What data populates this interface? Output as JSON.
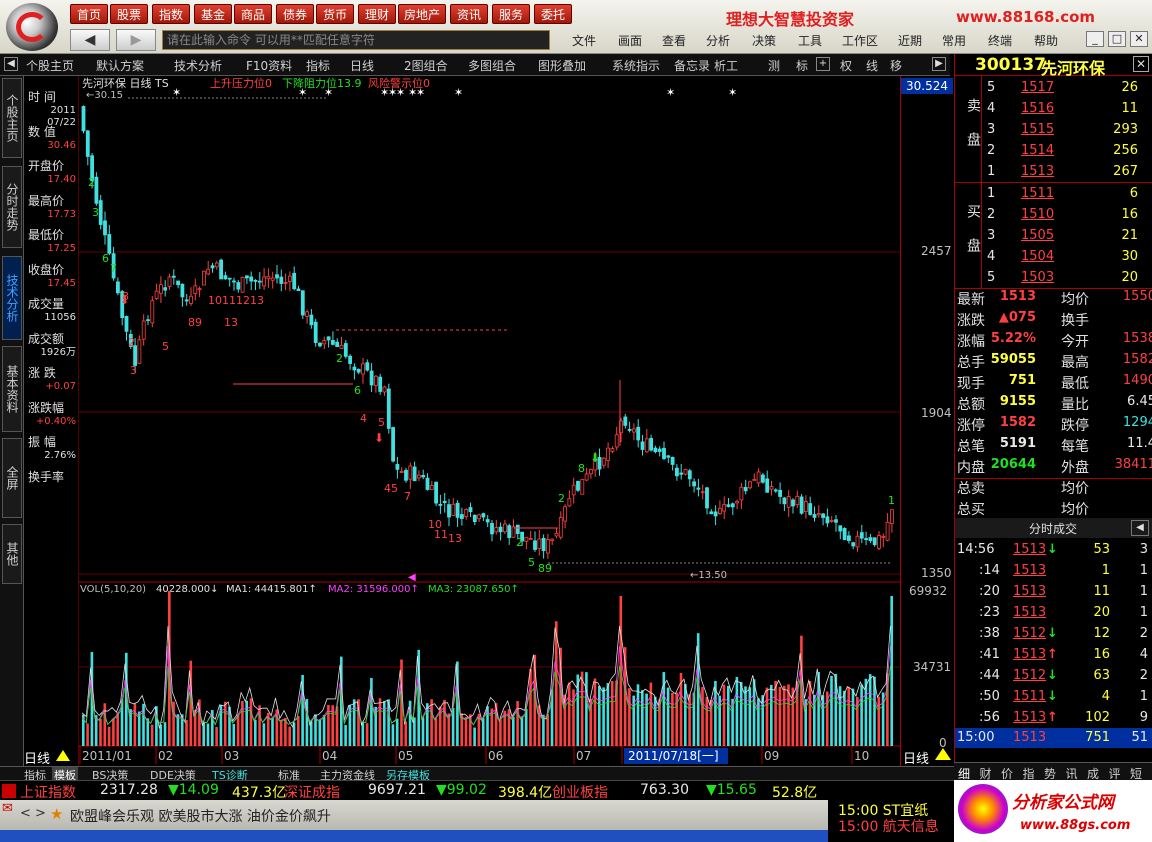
{
  "top_menu": [
    "首页",
    "股票",
    "指数",
    "基金",
    "商品",
    "债券",
    "货币",
    "理财",
    "房地产",
    "资讯",
    "服务",
    "委托"
  ],
  "brand": "理想大智慧投资家",
  "site": "www.88168.com",
  "command_placeholder": "请在此输入命令  可以用**匹配任意字符",
  "menus": [
    "文件",
    "画面",
    "查看",
    "分析",
    "决策",
    "工具",
    "工作区",
    "近期",
    "常用",
    "终端",
    "帮助"
  ],
  "toolbar": [
    "个股主页",
    "默认方案",
    "技术分析",
    "F10资料",
    "指标",
    "日线",
    "2图组合",
    "多图组合",
    "图形叠加",
    "系统指示",
    "备忘录",
    "析工",
    "测",
    "标",
    "权",
    "线",
    "移"
  ],
  "left_tabs": [
    "个股主页",
    "分时走势",
    "技术分析",
    "基本资料",
    "全屏",
    "其他"
  ],
  "data_panel": [
    {
      "label": "时  间",
      "value": "2011\n07/22"
    },
    {
      "label": "数  值",
      "value": "30.46"
    },
    {
      "label": "开盘价",
      "value": "17.40"
    },
    {
      "label": "最高价",
      "value": "17.73"
    },
    {
      "label": "最低价",
      "value": "17.25"
    },
    {
      "label": "收盘价",
      "value": "17.45"
    },
    {
      "label": "成交量",
      "value": "11056"
    },
    {
      "label": "成交额",
      "value": "1926万"
    },
    {
      "label": "涨  跌",
      "value": "+0.07"
    },
    {
      "label": "涨跌幅",
      "value": "+0.40%"
    },
    {
      "label": "振  幅",
      "value": "2.76%"
    },
    {
      "label": "换手率",
      "value": ""
    }
  ],
  "chart": {
    "legend_price": "先河环保 日线 TS",
    "legend_up": "上升压力位0",
    "legend_down": "下降阻力位13.9",
    "legend_risk": "风险警示位0",
    "high_tag": "30.524",
    "top_label": "←30.15",
    "low_label": "←13.50",
    "price_ticks": [
      "2457",
      "1904",
      "1350"
    ],
    "vol_legend": "VOL(5,10,20)",
    "vol_val": "40228.000↓",
    "ma1": "MA1: 44415.801↑",
    "ma2": "MA2: 31596.000↑",
    "ma3": "MA3: 23087.650↑",
    "vol_ticks": [
      "69932",
      "34731",
      "0"
    ],
    "x_labels": [
      "2011/01",
      "02",
      "03",
      "04",
      "05",
      "06",
      "07",
      "08",
      "09",
      "10"
    ],
    "x_highlight": "2011/07/18[一]",
    "period": "日线"
  },
  "rpanel": {
    "code": "300137",
    "name": "先河环保",
    "sell_label": "卖盘",
    "buy_label": "买盘",
    "sell": [
      [
        "5",
        "1517",
        "26"
      ],
      [
        "4",
        "1516",
        "11"
      ],
      [
        "3",
        "1515",
        "293"
      ],
      [
        "2",
        "1514",
        "256"
      ],
      [
        "1",
        "1513",
        "267"
      ]
    ],
    "buy": [
      [
        "1",
        "1511",
        "6"
      ],
      [
        "2",
        "1510",
        "16"
      ],
      [
        "3",
        "1505",
        "21"
      ],
      [
        "4",
        "1504",
        "30"
      ],
      [
        "5",
        "1503",
        "20"
      ]
    ],
    "stats": [
      [
        "最新",
        "1513",
        "均价",
        "1550"
      ],
      [
        "涨跌",
        "▲075",
        "换手",
        ""
      ],
      [
        "涨幅",
        "5.22%",
        "今开",
        "1538"
      ],
      [
        "总手",
        "59055",
        "最高",
        "1582"
      ],
      [
        "现手",
        "751",
        "最低",
        "1490"
      ],
      [
        "总额",
        "9155",
        "量比",
        "6.45"
      ],
      [
        "涨停",
        "1582",
        "跌停",
        "1294"
      ],
      [
        "总笔",
        "5191",
        "每笔",
        "11.4"
      ],
      [
        "内盘",
        "20644",
        "外盘",
        "38411"
      ],
      [
        "总卖",
        "",
        "均价",
        ""
      ],
      [
        "总买",
        "",
        "均价",
        ""
      ]
    ],
    "ticks_title": "分时成交",
    "ticks": [
      [
        "14:56",
        "1513",
        "↓",
        "53",
        "3"
      ],
      [
        ":14",
        "1513",
        "",
        "1",
        "1"
      ],
      [
        ":20",
        "1513",
        "",
        "11",
        "1"
      ],
      [
        ":23",
        "1513",
        "",
        "20",
        "1"
      ],
      [
        ":38",
        "1512",
        "↓",
        "12",
        "2"
      ],
      [
        ":41",
        "1513",
        "↑",
        "16",
        "4"
      ],
      [
        ":44",
        "1512",
        "↓",
        "63",
        "2"
      ],
      [
        ":50",
        "1511",
        "↓",
        "4",
        "1"
      ],
      [
        ":56",
        "1513",
        "↑",
        "102",
        "9"
      ]
    ],
    "last": [
      "15:00",
      "1513",
      "751",
      "51"
    ],
    "tabs": [
      "细",
      "财",
      "价",
      "指",
      "势",
      "讯",
      "成",
      "评",
      "短"
    ]
  },
  "bottom_tabs": [
    "指标",
    "模板",
    "BS决策",
    "DDE决策",
    "TS诊断",
    "标准",
    "主力资金线",
    "另存模板"
  ],
  "ticker": {
    "sh_name": "上证指数",
    "sh_val": "2317.28",
    "sh_chg": "▼14.09",
    "sh_amt": "437.3亿",
    "sz_name": "深证成指",
    "sz_val": "9697.21",
    "sz_chg": "▼99.02",
    "sz_amt": "398.4亿",
    "cy_name": "创业板指",
    "cy_val": "763.30",
    "cy_chg": "▼15.65",
    "cy_amt": "52.8亿"
  },
  "news": "欧盟峰会乐观 欧美股市大涨 油价金价飙升",
  "alerts": [
    "15:00 ST宜纸",
    "15:00 航天信息"
  ],
  "ad": {
    "title": "分析家公式网",
    "url": "www.88gs.com"
  },
  "colors": {
    "up": "#ff4040",
    "down": "#40e0e0",
    "bg": "#000000",
    "grid": "#800000"
  }
}
